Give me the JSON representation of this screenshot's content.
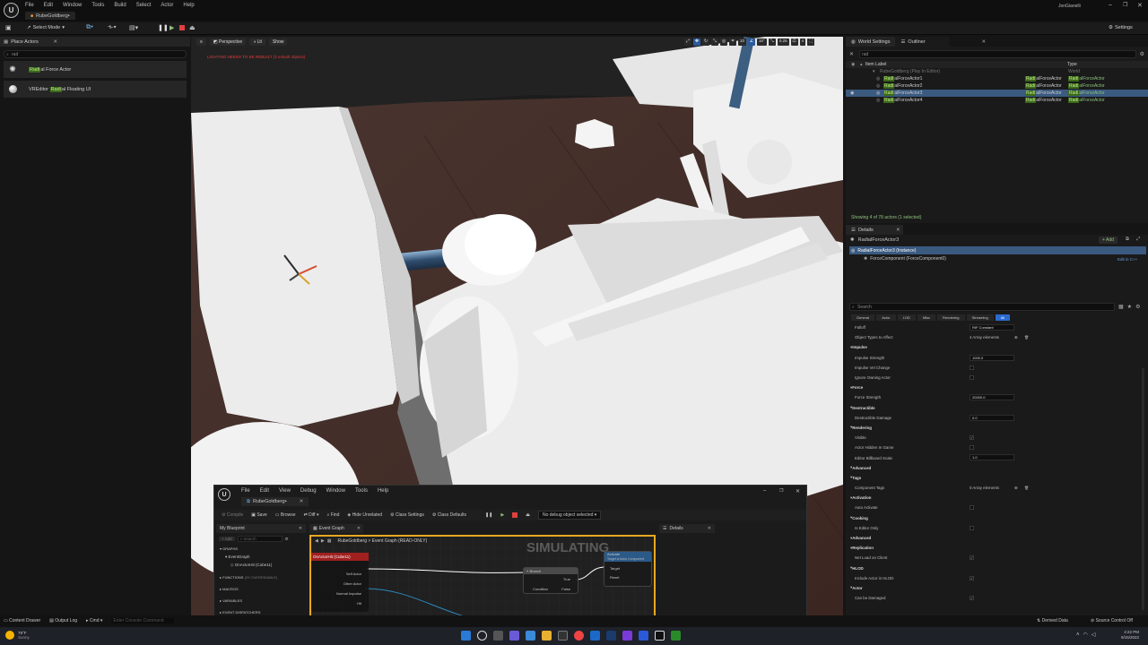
{
  "app": {
    "logo": "U",
    "menu": [
      "File",
      "Edit",
      "Window",
      "Tools",
      "Build",
      "Select",
      "Actor",
      "Help"
    ],
    "tab_title": "RubeGoldberg•",
    "user": "JonGianelli"
  },
  "toolbar": {
    "select_mode": "Select Mode",
    "settings": "Settings"
  },
  "place_actors": {
    "tab": "Place Actors",
    "search": "rad",
    "items": [
      {
        "pre": "",
        "hl": "Radi",
        "post": "al Force Actor"
      },
      {
        "pre": "VREditor ",
        "hl": "Radi",
        "post": "al Floating UI"
      }
    ]
  },
  "viewport": {
    "perspective": "Perspective",
    "lit": "Lit",
    "show": "Show",
    "warning": "LIGHTING NEEDS TO BE REBUILT (3 unbuilt objects)",
    "grid_value": "10",
    "angle_value": "10°",
    "scale_value": "0.25",
    "camera_speed": "4"
  },
  "outliner": {
    "tabs": [
      "World Settings",
      "Outliner"
    ],
    "search": "rad",
    "col_label": "Item Label",
    "col_type": "Type",
    "root": "RubeGoldberg (Play In Editor)",
    "root_type": "World",
    "rows": [
      {
        "hl": "Radi",
        "label": "alForceActor1",
        "type_hl": "Radi",
        "type": "alForceActor"
      },
      {
        "hl": "Radi",
        "label": "alForceActor2",
        "type_hl": "Radi",
        "type": "alForceActor"
      },
      {
        "hl": "Radi",
        "label": "alForceActor3",
        "type_hl": "Radi",
        "type": "alForceActor"
      },
      {
        "hl": "Radi",
        "label": "alForceActor4",
        "type_hl": "Radi",
        "type": "alForceActor"
      }
    ],
    "status": "Showing 4 of 78 actors (1 selected)"
  },
  "details": {
    "tab": "Details",
    "actor_name": "RadialForceActor3",
    "add": "+ Add",
    "instance": "RadialForceActor3 (Instance)",
    "component": "ForceComponent (ForceComponent0)",
    "edit_cpp": "Edit in C++",
    "search_placeholder": "Search",
    "filters": [
      "General",
      "Actor",
      "LOD",
      "Misc",
      "Rendering",
      "Streaming",
      "All"
    ],
    "properties": [
      {
        "label": "Falloff",
        "type": "value",
        "value": "RIF Constant"
      },
      {
        "label": "Object Types to Affect",
        "type": "text",
        "value": "4 Array elements"
      },
      {
        "label": "Impulse",
        "type": "cat"
      },
      {
        "label": "Impulse Strength",
        "type": "value",
        "value": "1000.0"
      },
      {
        "label": "Impulse Vel Change",
        "type": "check",
        "value": ""
      },
      {
        "label": "Ignore Owning Actor",
        "type": "check",
        "value": ""
      },
      {
        "label": "Force",
        "type": "cat"
      },
      {
        "label": "Force Strength",
        "type": "value",
        "value": "20000.0"
      },
      {
        "label": "Destructible",
        "type": "cat"
      },
      {
        "label": "Destructible Damage",
        "type": "value",
        "value": "0.0"
      },
      {
        "label": "Rendering",
        "type": "cat"
      },
      {
        "label": "Visible",
        "type": "check",
        "value": "✓"
      },
      {
        "label": "Actor Hidden In Game",
        "type": "check",
        "value": ""
      },
      {
        "label": "Editor Billboard Scale",
        "type": "value",
        "value": "1.0"
      },
      {
        "label": "Advanced",
        "type": "cat"
      },
      {
        "label": "Tags",
        "type": "cat"
      },
      {
        "label": "Component Tags",
        "type": "text",
        "value": "0 Array elements"
      },
      {
        "label": "Activation",
        "type": "cat"
      },
      {
        "label": "Auto Activate",
        "type": "check",
        "value": ""
      },
      {
        "label": "Cooking",
        "type": "cat"
      },
      {
        "label": "Is Editor Only",
        "type": "check",
        "value": ""
      },
      {
        "label": "Advanced",
        "type": "cat"
      },
      {
        "label": "Replication",
        "type": "cat"
      },
      {
        "label": "Net Load on Client",
        "type": "check",
        "value": "✓"
      },
      {
        "label": "HLOD",
        "type": "cat"
      },
      {
        "label": "Include Actor in HLOD",
        "type": "check",
        "value": "✓"
      },
      {
        "label": "Actor",
        "type": "cat"
      },
      {
        "label": "Can be Damaged",
        "type": "check",
        "value": "✓"
      }
    ]
  },
  "blueprint": {
    "logo": "U",
    "menu": [
      "File",
      "Edit",
      "View",
      "Debug",
      "Window",
      "Tools",
      "Help"
    ],
    "tab": "RubeGoldberg•",
    "toolbar": [
      "Compile",
      "Save",
      "Browse",
      "Diff",
      "Find",
      "Hide Unrelated",
      "Class Settings",
      "Class Defaults"
    ],
    "debug_select": "No debug object selected",
    "my_blueprint": "My Blueprint",
    "add": "+ Add",
    "search": "Search",
    "graphs": "GRAPHS",
    "event_graph": "EventGraph",
    "event_node": "OnActorHit (Cube11)",
    "functions": "FUNCTIONS",
    "functions_count": "(29 OVERRIDABLE)",
    "macros": "MACROS",
    "variables": "VARIABLES",
    "dispatchers": "EVENT DISPATCHERS",
    "graph_tab": "Event Graph",
    "breadcrumb": "RubeGoldberg  >  Event Graph  (READ-ONLY)",
    "simulating": "SIMULATING",
    "node_header": "OnActorHit (Cube11)",
    "node_pins": [
      "Self Actor",
      "Other Actor",
      "Normal Impulse",
      "Hit"
    ],
    "branch": "Branch",
    "branch_pins": [
      "Condition",
      "True",
      "False"
    ],
    "activate": "Activate",
    "activate_sub": "Target is Actor Component",
    "activate_pins": [
      "Target",
      "Reset"
    ],
    "details_tab": "Details"
  },
  "statusbar": {
    "content_drawer": "Content Drawer",
    "output_log": "Output Log",
    "cmd": "Cmd",
    "console": "Enter Console Command",
    "derived": "Derived Data",
    "source": "Source Control Off"
  },
  "taskbar": {
    "weather_temp": "79°F",
    "weather_desc": "Sunny",
    "time": "4:22 PM",
    "date": "9/15/2022"
  }
}
